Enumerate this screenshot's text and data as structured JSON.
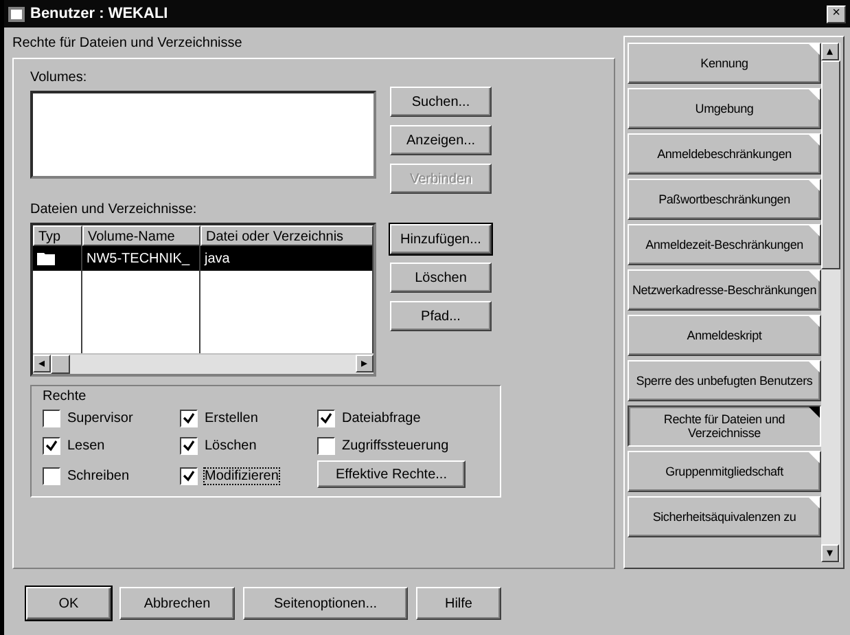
{
  "window": {
    "title": "Benutzer : WEKALI",
    "close": "×"
  },
  "page_title": "Rechte für Dateien und Verzeichnisse",
  "volumes": {
    "label": "Volumes:",
    "buttons": [
      {
        "label": "Suchen...",
        "disabled": false
      },
      {
        "label": "Anzeigen...",
        "disabled": false
      },
      {
        "label": "Verbinden",
        "disabled": true
      }
    ]
  },
  "files": {
    "label": "Dateien und Verzeichnisse:",
    "columns": [
      "Typ",
      "Volume-Name",
      "Datei oder Verzeichnis"
    ],
    "rows": [
      {
        "volume": "NW5-TECHNIK_",
        "path": "java",
        "selected": true
      }
    ],
    "scroll_left": "◂",
    "scroll_right": "▸",
    "buttons": [
      {
        "label": "Hinzufügen...",
        "default": true
      },
      {
        "label": "Löschen",
        "default": false
      },
      {
        "label": "Pfad...",
        "default": false
      }
    ]
  },
  "rights": {
    "label": "Rechte",
    "items": [
      {
        "label": "Supervisor",
        "checked": false,
        "focused": false
      },
      {
        "label": "Erstellen",
        "checked": true,
        "focused": false
      },
      {
        "label": "Dateiabfrage",
        "checked": true,
        "focused": false
      },
      {
        "label": "Lesen",
        "checked": true,
        "focused": false
      },
      {
        "label": "Löschen",
        "checked": true,
        "focused": false
      },
      {
        "label": "Zugriffssteuerung",
        "checked": false,
        "focused": false
      },
      {
        "label": "Schreiben",
        "checked": false,
        "focused": false
      },
      {
        "label": "Modifizieren",
        "checked": true,
        "focused": true
      }
    ],
    "effective_button": "Effektive Rechte..."
  },
  "pages": [
    {
      "label": "Kennung",
      "selected": false
    },
    {
      "label": "Umgebung",
      "selected": false
    },
    {
      "label": "Anmeldebeschränkungen",
      "selected": false
    },
    {
      "label": "Paßwortbeschränkungen",
      "selected": false
    },
    {
      "label": "Anmeldezeit-Beschränkungen",
      "selected": false
    },
    {
      "label": "Netzwerkadresse-Beschränkungen",
      "selected": false
    },
    {
      "label": "Anmeldeskript",
      "selected": false
    },
    {
      "label": "Sperre des unbefugten Benutzers",
      "selected": false
    },
    {
      "label": "Rechte für Dateien und Verzeichnisse",
      "selected": true
    },
    {
      "label": "Gruppenmitgliedschaft",
      "selected": false
    },
    {
      "label": "Sicherheitsäquivalenzen zu",
      "selected": false
    }
  ],
  "scroll_up": "▴",
  "scroll_down": "▾",
  "buttons": [
    "OK",
    "Abbrechen",
    "Seitenoptionen...",
    "Hilfe"
  ]
}
